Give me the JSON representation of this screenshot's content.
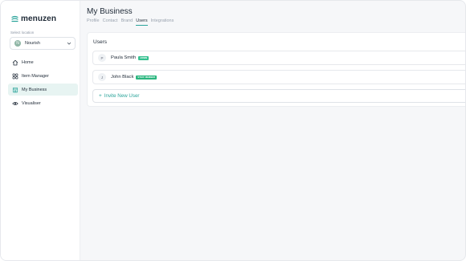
{
  "brand": {
    "name": "menuzen",
    "accent": "#2aa39a"
  },
  "location": {
    "label": "Select location",
    "value": "Nourish",
    "avatar_letter": "N"
  },
  "nav": [
    {
      "icon": "home-icon",
      "label": "Home",
      "active": false
    },
    {
      "icon": "grid-icon",
      "label": "Item Manager",
      "active": false
    },
    {
      "icon": "store-icon",
      "label": "My Business",
      "active": true
    },
    {
      "icon": "eye-icon",
      "label": "Visualiser",
      "active": false
    }
  ],
  "page": {
    "title": "My Business",
    "tabs": [
      "Profile",
      "Contact",
      "Brand",
      "Users",
      "Integrations"
    ],
    "active_tab": "Users"
  },
  "users_panel": {
    "title": "Users",
    "users": [
      {
        "initial": "P",
        "name": "Paula Smith",
        "badge": "ADMIN"
      },
      {
        "initial": "J",
        "name": "John Black",
        "badge": "STAFF MEMBER"
      }
    ],
    "invite_label": "Invite New User"
  }
}
